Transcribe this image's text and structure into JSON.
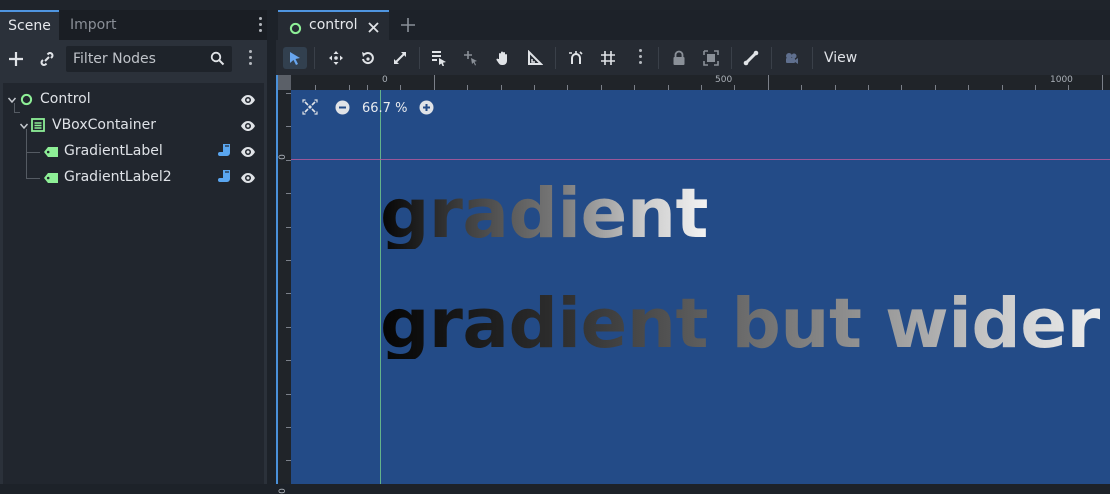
{
  "dock": {
    "tabs": {
      "scene": "Scene",
      "import": "Import"
    },
    "filter_placeholder": "Filter Nodes",
    "tree": [
      {
        "label": "Control"
      },
      {
        "label": "VBoxContainer"
      },
      {
        "label": "GradientLabel"
      },
      {
        "label": "GradientLabel2"
      }
    ]
  },
  "editor": {
    "scene_tab": "control",
    "view_menu": "View",
    "zoom": "66.7 %",
    "ruler": {
      "h_labels": [
        "0",
        "500",
        "1000"
      ],
      "v_labels": [
        "0",
        "0",
        "0"
      ]
    }
  },
  "canvas_text": {
    "label1": "gradient",
    "label2": "gradient but wider"
  },
  "colors": {
    "accent": "#4f95e0",
    "node_control": "#8eef97",
    "script": "#5aa6f0",
    "viewport_bg": "#234b87"
  }
}
